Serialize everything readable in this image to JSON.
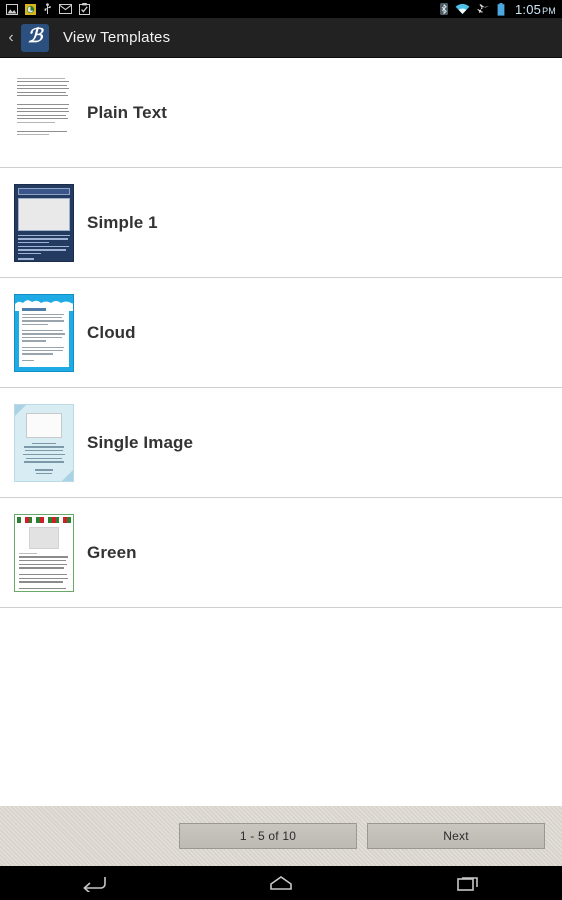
{
  "status_bar": {
    "left_icons": [
      "image-icon",
      "app-update-icon",
      "usb-icon",
      "email-icon",
      "clipboard-icon"
    ],
    "right_icons": [
      "bluetooth-icon",
      "wifi-icon",
      "airplane-mode-icon",
      "battery-icon"
    ],
    "time": "1:05",
    "meridiem": "PM",
    "time_color": "#cfe8f5"
  },
  "app_bar": {
    "back_glyph": "‹",
    "logo_letter": "ℬ",
    "logo_color": "#2b5080",
    "title": "View Templates"
  },
  "templates": [
    {
      "name": "Plain Text",
      "thumb": "plain-text-thumbnail"
    },
    {
      "name": "Simple 1",
      "thumb": "simple-1-thumbnail"
    },
    {
      "name": "Cloud",
      "thumb": "cloud-thumbnail"
    },
    {
      "name": "Single Image",
      "thumb": "single-image-thumbnail"
    },
    {
      "name": "Green",
      "thumb": "green-thumbnail"
    }
  ],
  "footer": {
    "page_indicator": "1 - 5 of 10",
    "next_label": "Next",
    "background_color": "#d8d4cb"
  },
  "nav_bar": {
    "back": "back-nav-icon",
    "home": "home-nav-icon",
    "recents": "recents-nav-icon"
  }
}
